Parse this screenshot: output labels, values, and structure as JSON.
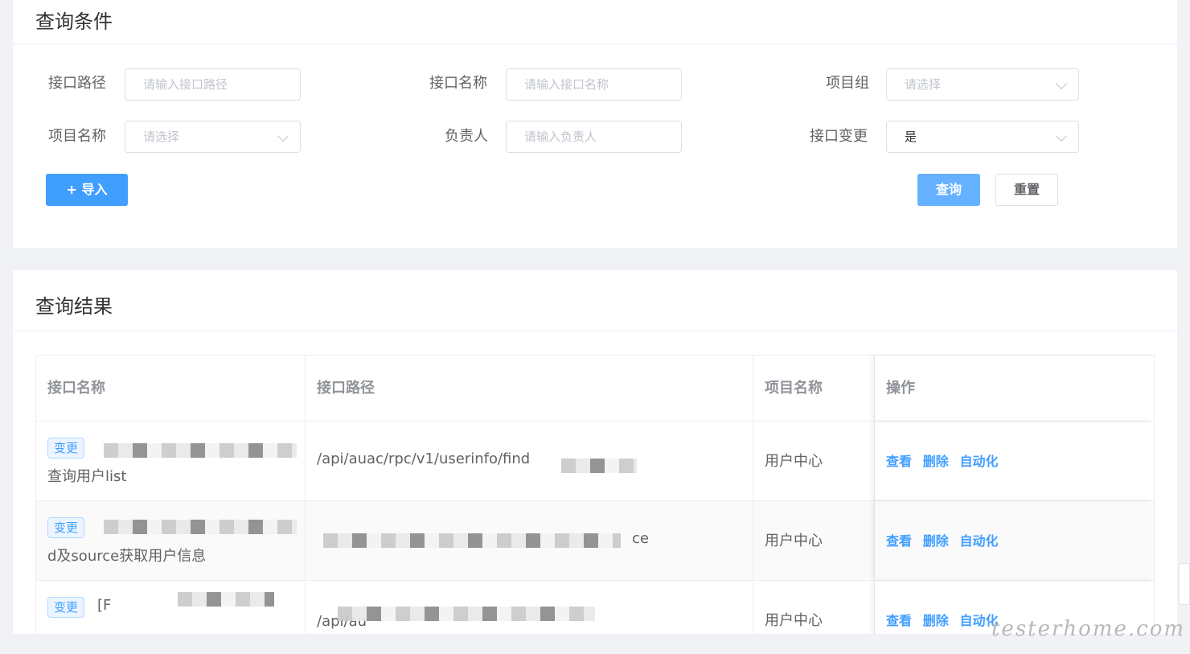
{
  "query": {
    "title": "查询条件",
    "path_label": "接口路径",
    "path_placeholder": "请输入接口路径",
    "name_label": "接口名称",
    "name_placeholder": "请输入接口名称",
    "group_label": "项目组",
    "group_placeholder": "请选择",
    "project_label": "项目名称",
    "project_placeholder": "请选择",
    "owner_label": "负责人",
    "owner_placeholder": "请输入负责人",
    "change_label": "接口变更",
    "change_value": "是",
    "import_button": "+ 导入",
    "search_button": "查询",
    "reset_button": "重置"
  },
  "results": {
    "title": "查询结果",
    "columns": [
      "接口名称",
      "接口路径",
      "项目名称",
      "操作"
    ],
    "rows": [
      {
        "tag": "变更",
        "name": "查询用户list",
        "path": "/api/auac/rpc/v1/userinfo/find",
        "project": "用户中心"
      },
      {
        "tag": "变更",
        "name": "d及source获取用户信息",
        "path": "ce",
        "project": "用户中心"
      },
      {
        "tag": "变更",
        "name": "[F",
        "path": "/api/au",
        "project": "用户中心"
      }
    ],
    "actions": {
      "view": "查看",
      "delete": "删除",
      "auto": "自动化"
    }
  },
  "watermark": "testerhome.com"
}
